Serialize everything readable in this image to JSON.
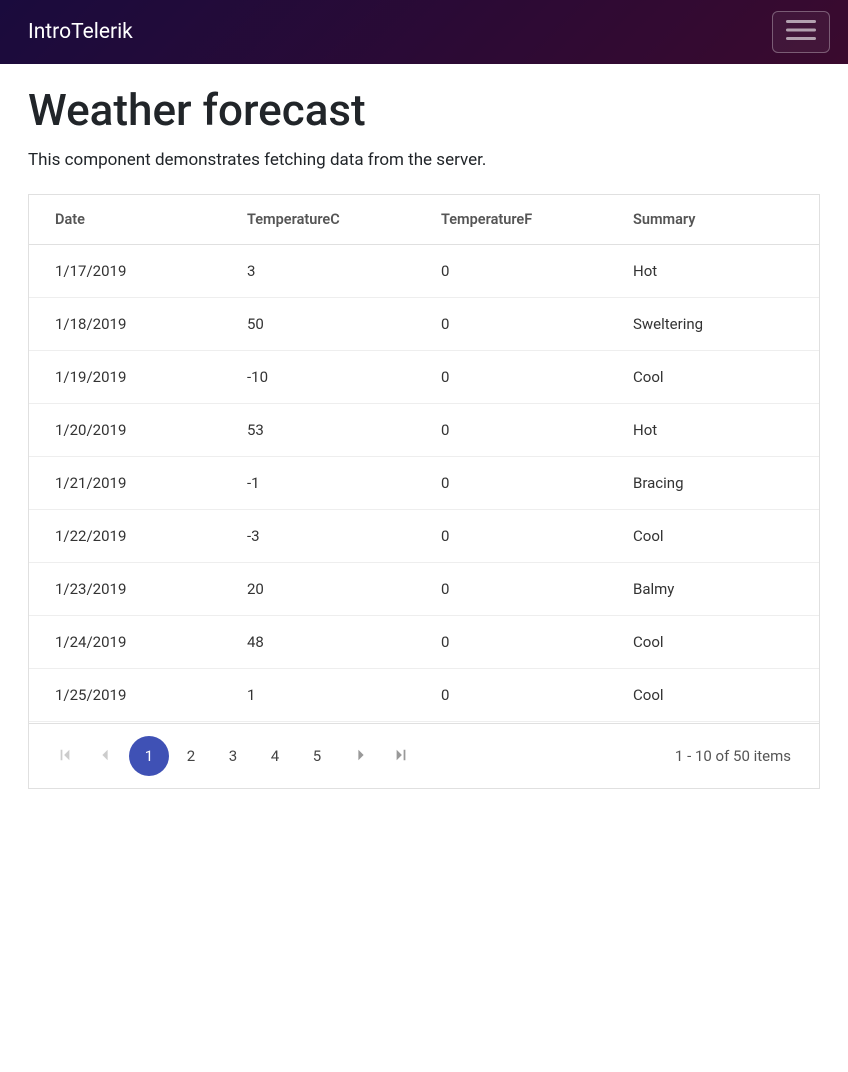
{
  "navbar": {
    "brand": "IntroTelerik"
  },
  "page": {
    "title": "Weather forecast",
    "subtitle": "This component demonstrates fetching data from the server."
  },
  "grid": {
    "columns": {
      "date": "Date",
      "tempc": "TemperatureC",
      "tempf": "TemperatureF",
      "summary": "Summary"
    },
    "rows": [
      {
        "date": "1/17/2019",
        "tempc": "3",
        "tempf": "0",
        "summary": "Hot"
      },
      {
        "date": "1/18/2019",
        "tempc": "50",
        "tempf": "0",
        "summary": "Sweltering"
      },
      {
        "date": "1/19/2019",
        "tempc": "-10",
        "tempf": "0",
        "summary": "Cool"
      },
      {
        "date": "1/20/2019",
        "tempc": "53",
        "tempf": "0",
        "summary": "Hot"
      },
      {
        "date": "1/21/2019",
        "tempc": "-1",
        "tempf": "0",
        "summary": "Bracing"
      },
      {
        "date": "1/22/2019",
        "tempc": "-3",
        "tempf": "0",
        "summary": "Cool"
      },
      {
        "date": "1/23/2019",
        "tempc": "20",
        "tempf": "0",
        "summary": "Balmy"
      },
      {
        "date": "1/24/2019",
        "tempc": "48",
        "tempf": "0",
        "summary": "Cool"
      },
      {
        "date": "1/25/2019",
        "tempc": "1",
        "tempf": "0",
        "summary": "Cool"
      }
    ]
  },
  "pager": {
    "pages": [
      "1",
      "2",
      "3",
      "4",
      "5"
    ],
    "active": "1",
    "info": "1 - 10 of 50 items"
  }
}
